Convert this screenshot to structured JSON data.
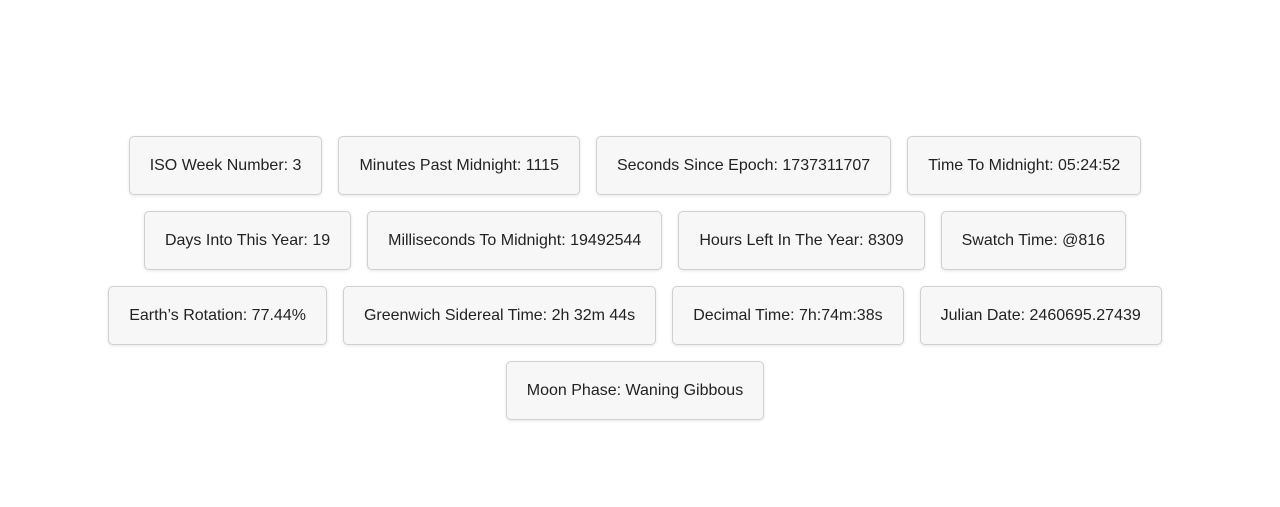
{
  "tiles": [
    {
      "id": "iso-week-number",
      "label": "ISO Week Number: 3"
    },
    {
      "id": "minutes-past-midnight",
      "label": "Minutes Past Midnight: 1115"
    },
    {
      "id": "seconds-since-epoch",
      "label": "Seconds Since Epoch: 1737311707"
    },
    {
      "id": "time-to-midnight",
      "label": "Time To Midnight: 05:24:52"
    },
    {
      "id": "days-into-year",
      "label": "Days Into This Year: 19"
    },
    {
      "id": "milliseconds-to-midnight",
      "label": "Milliseconds To Midnight: 19492544"
    },
    {
      "id": "hours-left-in-year",
      "label": "Hours Left In The Year: 8309"
    },
    {
      "id": "swatch-time",
      "label": "Swatch Time: @816"
    },
    {
      "id": "earths-rotation",
      "label": "Earth’s Rotation: 77.44%"
    },
    {
      "id": "greenwich-sidereal-time",
      "label": "Greenwich Sidereal Time: 2h 32m 44s"
    },
    {
      "id": "decimal-time",
      "label": "Decimal Time: 7h:74m:38s"
    },
    {
      "id": "julian-date",
      "label": "Julian Date: 2460695.27439"
    },
    {
      "id": "moon-phase",
      "label": "Moon Phase: Waning Gibbous"
    }
  ]
}
